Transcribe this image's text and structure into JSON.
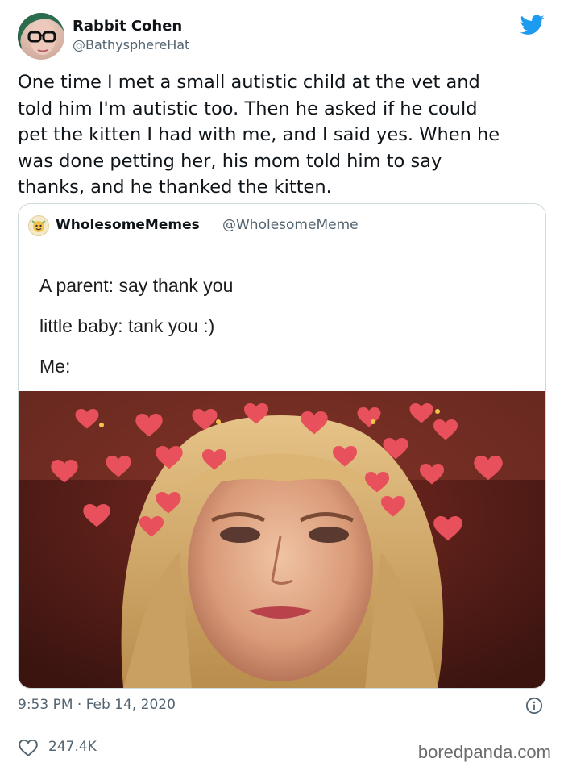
{
  "author": {
    "display_name": "Rabbit Cohen",
    "handle": "@BathysphereHat"
  },
  "tweet": {
    "text": "One time I met a small autistic child at the vet and\ntold him I'm autistic too. Then he asked if he could\npet the kitten I had with me, and I said yes. When he\nwas done petting her, his mom told him to say\nthanks, and he thanked the kitten.",
    "timestamp": "9:53 PM · Feb 14, 2020",
    "likes": "247.4K"
  },
  "quoted_tweet": {
    "display_name": "WholesomeMemes",
    "handle": "@WholesomeMeme",
    "meme_lines": [
      "A parent: say thank you",
      "little baby: tank you :)",
      "Me:"
    ]
  },
  "watermark": "boredpanda.com",
  "colors": {
    "brand_blue": "#1d9bf0",
    "text_primary": "#0f1419",
    "text_secondary": "#536471",
    "border": "#cfd9de"
  },
  "icons": {
    "brand": "twitter-bird-icon",
    "info": "info-icon",
    "like": "heart-outline-icon"
  }
}
